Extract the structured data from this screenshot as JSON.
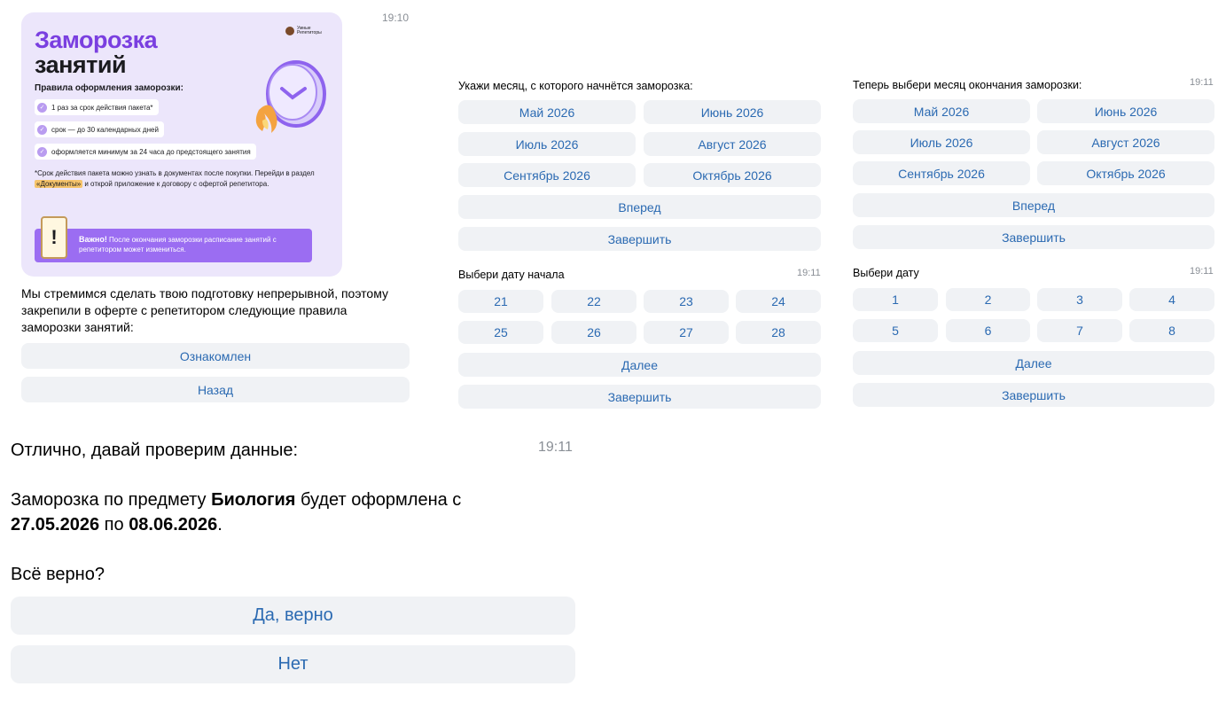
{
  "msg1": {
    "time": "19:10",
    "banner": {
      "title_line1": "Заморозка",
      "title_line2": "занятий",
      "logo_text": "Умные Репетиторы",
      "subtitle": "Правила оформления заморозки:",
      "rules": [
        "1 раз за срок действия пакета*",
        "срок — до 30 календарных дней",
        "оформляется минимум за 24 часа до предстоящего занятия"
      ],
      "note_before": "*Срок действия пакета можно узнать в документах после покупки. Перейди в раздел ",
      "note_highlight": "«Документы»",
      "note_after": " и открой приложение к договору с офертой репетитора.",
      "warning_title": "Важно!",
      "warning_text": " После окончания заморозки расписание занятий с репетитором может измениться.",
      "warning_icon": "!"
    },
    "text": "Мы стремимся сделать твою подготовку непрерывной, поэтому закрепили в оферте с репетитором следующие правила заморозки занятий:",
    "buttons": [
      "Ознакомлен",
      "Назад"
    ]
  },
  "msg2": {
    "prompt": "Укажи месяц, с которого начнётся заморозка:",
    "months": [
      "Май 2026",
      "Июнь 2026",
      "Июль 2026",
      "Август 2026",
      "Сентябрь 2026",
      "Октябрь 2026"
    ],
    "forward": "Вперед",
    "finish": "Завершить"
  },
  "msg3": {
    "prompt": "Теперь выбери месяц окончания заморозки:",
    "time": "19:11",
    "months": [
      "Май 2026",
      "Июнь 2026",
      "Июль 2026",
      "Август 2026",
      "Сентябрь 2026",
      "Октябрь 2026"
    ],
    "forward": "Вперед",
    "finish": "Завершить"
  },
  "msg4": {
    "prompt": "Выбери дату начала",
    "time": "19:11",
    "dates": [
      "21",
      "22",
      "23",
      "24",
      "25",
      "26",
      "27",
      "28"
    ],
    "next": "Далее",
    "finish": "Завершить"
  },
  "msg5": {
    "prompt": "Выбери дату",
    "time": "19:11",
    "dates": [
      "1",
      "2",
      "3",
      "4",
      "5",
      "6",
      "7",
      "8"
    ],
    "next": "Далее",
    "finish": "Завершить"
  },
  "msg6": {
    "line1": "Отлично, давай проверим данные:",
    "time": "19:11",
    "p2_a": "Заморозка по предмету ",
    "p2_subject": "Биология",
    "p2_b": " будет оформлена с",
    "p2_from": "27.05.2026",
    "p2_c": " по ",
    "p2_to": "08.06.2026",
    "p2_d": ".",
    "question": "Всё верно?",
    "yes": "Да, верно",
    "no": "Нет"
  },
  "colors": {
    "accent": "#2b6ab2",
    "button_bg": "#f0f2f5",
    "brand_purple": "#7a3fe0",
    "time_gray": "#8a8f96"
  },
  "icons": [
    "check-icon",
    "clock-illustration",
    "exclamation-icon",
    "logo-icon"
  ]
}
